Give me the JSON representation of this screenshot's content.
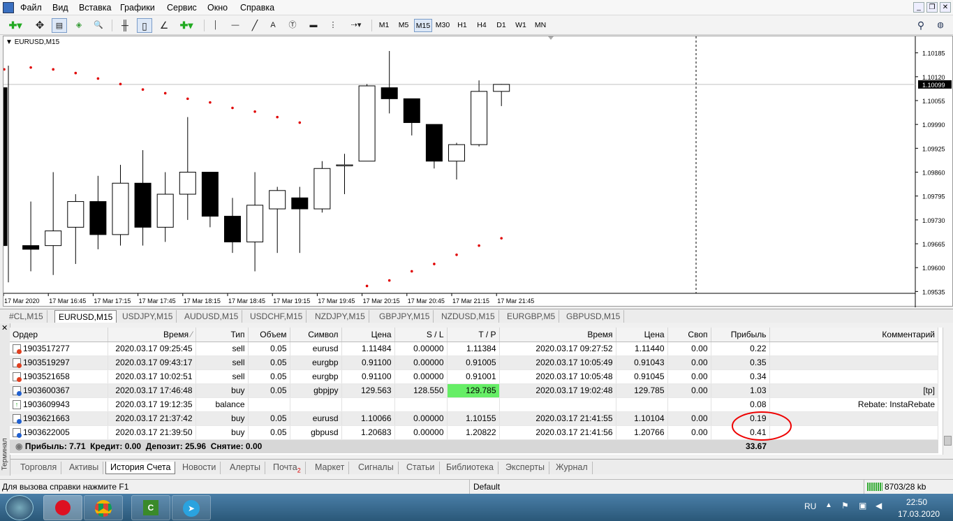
{
  "menu": {
    "items": [
      "Файл",
      "Вид",
      "Вставка",
      "Графики",
      "Сервис",
      "Окно",
      "Справка"
    ]
  },
  "toolbar": {
    "timeframes": [
      "M1",
      "M5",
      "M15",
      "M30",
      "H1",
      "H4",
      "D1",
      "W1",
      "MN"
    ],
    "active_timeframe": "M15"
  },
  "chart": {
    "title": "EURUSD,M15",
    "current_price": "1.10099"
  },
  "chart_data": {
    "type": "candlestick",
    "title": "EURUSD,M15",
    "price_ticks": [
      "1.10185",
      "1.10120",
      "1.10055",
      "1.09990",
      "1.09925",
      "1.09860",
      "1.09795",
      "1.09730",
      "1.09665",
      "1.09600",
      "1.09535"
    ],
    "time_ticks": [
      "17 Mar 2020",
      "17 Mar 16:45",
      "17 Mar 17:15",
      "17 Mar 17:45",
      "17 Mar 18:15",
      "17 Mar 18:45",
      "17 Mar 19:15",
      "17 Mar 19:45",
      "17 Mar 20:15",
      "17 Mar 20:45",
      "17 Mar 21:15",
      "17 Mar 21:45"
    ],
    "ylim": [
      1.0953,
      1.1023
    ],
    "candles": [
      {
        "o": 1.1009,
        "h": 1.1015,
        "l": 1.0956,
        "c": 1.0966
      },
      {
        "o": 1.0966,
        "h": 1.0978,
        "l": 1.0959,
        "c": 1.0965
      },
      {
        "o": 1.0966,
        "h": 1.0986,
        "l": 1.0958,
        "c": 1.097
      },
      {
        "o": 1.0971,
        "h": 1.098,
        "l": 1.0961,
        "c": 1.0978
      },
      {
        "o": 1.0978,
        "h": 1.0985,
        "l": 1.0965,
        "c": 1.0969
      },
      {
        "o": 1.0969,
        "h": 1.0988,
        "l": 1.0966,
        "c": 1.0983
      },
      {
        "o": 1.0983,
        "h": 1.0992,
        "l": 1.0966,
        "c": 1.0971
      },
      {
        "o": 1.0971,
        "h": 1.0986,
        "l": 1.0967,
        "c": 1.098
      },
      {
        "o": 1.098,
        "h": 1.1001,
        "l": 1.0973,
        "c": 1.0986
      },
      {
        "o": 1.0986,
        "h": 1.0986,
        "l": 1.0971,
        "c": 1.0974
      },
      {
        "o": 1.0974,
        "h": 1.0979,
        "l": 1.0964,
        "c": 1.0967
      },
      {
        "o": 1.0967,
        "h": 1.0986,
        "l": 1.0959,
        "c": 1.0977
      },
      {
        "o": 1.0976,
        "h": 1.0982,
        "l": 1.0964,
        "c": 1.0981
      },
      {
        "o": 1.0979,
        "h": 1.0982,
        "l": 1.0964,
        "c": 1.0976
      },
      {
        "o": 1.0976,
        "h": 1.0989,
        "l": 1.0975,
        "c": 1.0987
      },
      {
        "o": 1.0988,
        "h": 1.0991,
        "l": 1.098,
        "c": 1.0988
      },
      {
        "o": 1.0989,
        "h": 1.101,
        "l": 1.0989,
        "c": 1.10095
      },
      {
        "o": 1.1009,
        "h": 1.1019,
        "l": 1.1002,
        "c": 1.1006
      },
      {
        "o": 1.1006,
        "h": 1.1006,
        "l": 1.0996,
        "c": 1.09995
      },
      {
        "o": 1.0999,
        "h": 1.0999,
        "l": 1.0987,
        "c": 1.0989
      },
      {
        "o": 1.0989,
        "h": 1.0994,
        "l": 1.0984,
        "c": 1.09935
      },
      {
        "o": 1.09935,
        "h": 1.1011,
        "l": 1.0993,
        "c": 1.1008
      },
      {
        "o": 1.1008,
        "h": 1.101,
        "l": 1.1004,
        "c": 1.10099
      }
    ],
    "sar": [
      1.1014,
      1.10145,
      1.1014,
      1.1013,
      1.10115,
      1.101,
      1.10085,
      1.10075,
      1.1006,
      1.1005,
      1.10035,
      1.10025,
      1.1001,
      1.09995,
      null,
      null,
      1.0955,
      1.09565,
      1.0959,
      1.0961,
      1.09635,
      1.0966,
      1.0968
    ]
  },
  "symbol_tabs": {
    "tabs": [
      "#CL,M15",
      "EURUSD,M15",
      "USDJPY,M15",
      "AUDUSD,M15",
      "USDCHF,M15",
      "NZDJPY,M15",
      "GBPJPY,M15",
      "NZDUSD,M15",
      "EURGBP,M5",
      "GBPUSD,M15"
    ],
    "active": "EURUSD,M15"
  },
  "history": {
    "columns": [
      "Ордер",
      "Время",
      "Тип",
      "Объем",
      "Символ",
      "Цена",
      "S / L",
      "T / P",
      "Время",
      "Цена",
      "Своп",
      "Прибыль",
      "Комментарий"
    ],
    "rows": [
      {
        "order": "1903517277",
        "time": "2020.03.17 09:25:45",
        "type": "sell",
        "volume": "0.05",
        "symbol": "eurusd",
        "price": "1.11484",
        "sl": "0.00000",
        "tp": "1.11384",
        "close_time": "2020.03.17 09:27:52",
        "close_price": "1.11440",
        "swap": "0.00",
        "profit": "0.22",
        "comment": ""
      },
      {
        "order": "1903519297",
        "time": "2020.03.17 09:43:17",
        "type": "sell",
        "volume": "0.05",
        "symbol": "eurgbp",
        "price": "0.91100",
        "sl": "0.00000",
        "tp": "0.91005",
        "close_time": "2020.03.17 10:05:49",
        "close_price": "0.91043",
        "swap": "0.00",
        "profit": "0.35",
        "comment": ""
      },
      {
        "order": "1903521658",
        "time": "2020.03.17 10:02:51",
        "type": "sell",
        "volume": "0.05",
        "symbol": "eurgbp",
        "price": "0.91100",
        "sl": "0.00000",
        "tp": "0.91001",
        "close_time": "2020.03.17 10:05:48",
        "close_price": "0.91045",
        "swap": "0.00",
        "profit": "0.34",
        "comment": ""
      },
      {
        "order": "1903600367",
        "time": "2020.03.17 17:46:48",
        "type": "buy",
        "volume": "0.05",
        "symbol": "gbpjpy",
        "price": "129.563",
        "sl": "128.550",
        "tp": "129.785",
        "close_time": "2020.03.17 19:02:48",
        "close_price": "129.785",
        "swap": "0.00",
        "profit": "1.03",
        "comment": "[tp]"
      },
      {
        "order": "1903609943",
        "time": "2020.03.17 19:12:35",
        "type": "balance",
        "volume": "",
        "symbol": "",
        "price": "",
        "sl": "",
        "tp": "",
        "close_time": "",
        "close_price": "",
        "swap": "",
        "profit": "0.08",
        "comment": "Rebate: InstaRebate"
      },
      {
        "order": "1903621663",
        "time": "2020.03.17 21:37:42",
        "type": "buy",
        "volume": "0.05",
        "symbol": "eurusd",
        "price": "1.10066",
        "sl": "0.00000",
        "tp": "1.10155",
        "close_time": "2020.03.17 21:41:55",
        "close_price": "1.10104",
        "swap": "0.00",
        "profit": "0.19",
        "comment": ""
      },
      {
        "order": "1903622005",
        "time": "2020.03.17 21:39:50",
        "type": "buy",
        "volume": "0.05",
        "symbol": "gbpusd",
        "price": "1.20683",
        "sl": "0.00000",
        "tp": "1.20822",
        "close_time": "2020.03.17 21:41:56",
        "close_price": "1.20766",
        "swap": "0.00",
        "profit": "0.41",
        "comment": ""
      }
    ],
    "summary": "Прибыль: 7.71  Кредит: 0.00  Депозит: 25.96  Снятие: 0.00",
    "total": "33.67"
  },
  "terminal_label": "Терминал",
  "bottom_tabs": {
    "tabs": [
      "Торговля",
      "Активы",
      "История Счета",
      "Новости",
      "Алерты",
      "Почта",
      "Маркет",
      "Сигналы",
      "Статьи",
      "Библиотека",
      "Эксперты",
      "Журнал"
    ],
    "active": "История Счета",
    "mail_badge": "2"
  },
  "status": {
    "help": "Для вызова справки нажмите F1",
    "profile": "Default",
    "traffic": "8703/28 kb"
  },
  "taskbar": {
    "lang": "RU",
    "time": "22:50",
    "date": "17.03.2020"
  },
  "colors": {
    "bull": "#ffffff",
    "bear": "#000000",
    "sar": "#e00000",
    "tp_hit": "#66ee66",
    "annotation": "#ee0000"
  }
}
